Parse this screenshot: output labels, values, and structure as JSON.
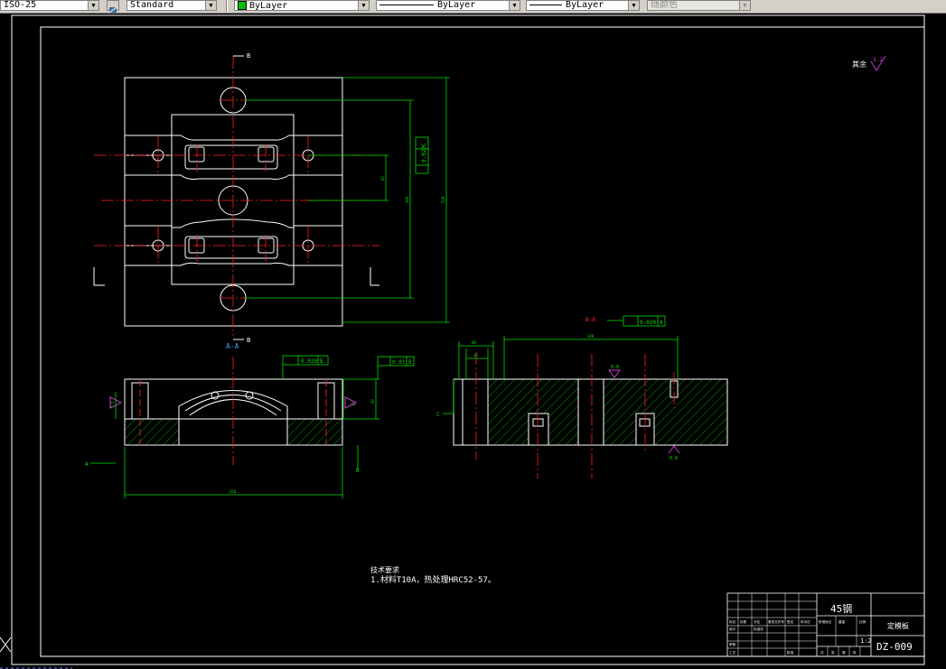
{
  "toolbar": {
    "dimstyle": "ISO-25",
    "textstyle": "Standard",
    "layer_color": "ByLayer",
    "linetype": "ByLayer",
    "lineweight": "ByLayer",
    "plotstyle": "随颜色",
    "layer_color_swatch": "#00c000"
  },
  "drawing": {
    "section_top_label": "B",
    "section_bottom_label": "B",
    "view_label_aa": "A-A",
    "view_label_bb": "B-B",
    "roughness_other": "其余",
    "roughness_other_value": "3.2",
    "roughness_1": "0.8",
    "roughness_2": "0.8",
    "datum_a": "A",
    "datum_b": "B",
    "datum_c": "C",
    "tol_flatness": "0.020",
    "tol_parallel": "0.020",
    "tol_perp": "0.01",
    "tol_bb": "0.020",
    "dim_width": "456",
    "dim_height_outer": "508",
    "dim_height_inner": "380",
    "dim_small": "85",
    "dim_section_h": "90",
    "dim_section_a": "7.5",
    "dim_section_b": "37",
    "dim_bb_len": "340",
    "dim_bb_a": "80",
    "dim_bb_b": "42",
    "tech_title": "技术要求",
    "tech_line1": "1.材料T10A，热处理HRC52-57。"
  },
  "title_block": {
    "material": "45钢",
    "part_name": "定模板",
    "scale": "1:2",
    "drawing_no": "DZ-009",
    "row_labels": [
      "标记",
      "处数",
      "分区",
      "更改文件号",
      "签名",
      "年月日"
    ],
    "sign_labels": [
      "设计",
      "标准化",
      "审核",
      "工艺",
      "批准"
    ],
    "stage_labels": [
      "阶段标记",
      "重量",
      "比例"
    ],
    "sheet_labels": [
      "共",
      "张",
      "第",
      "张"
    ]
  }
}
